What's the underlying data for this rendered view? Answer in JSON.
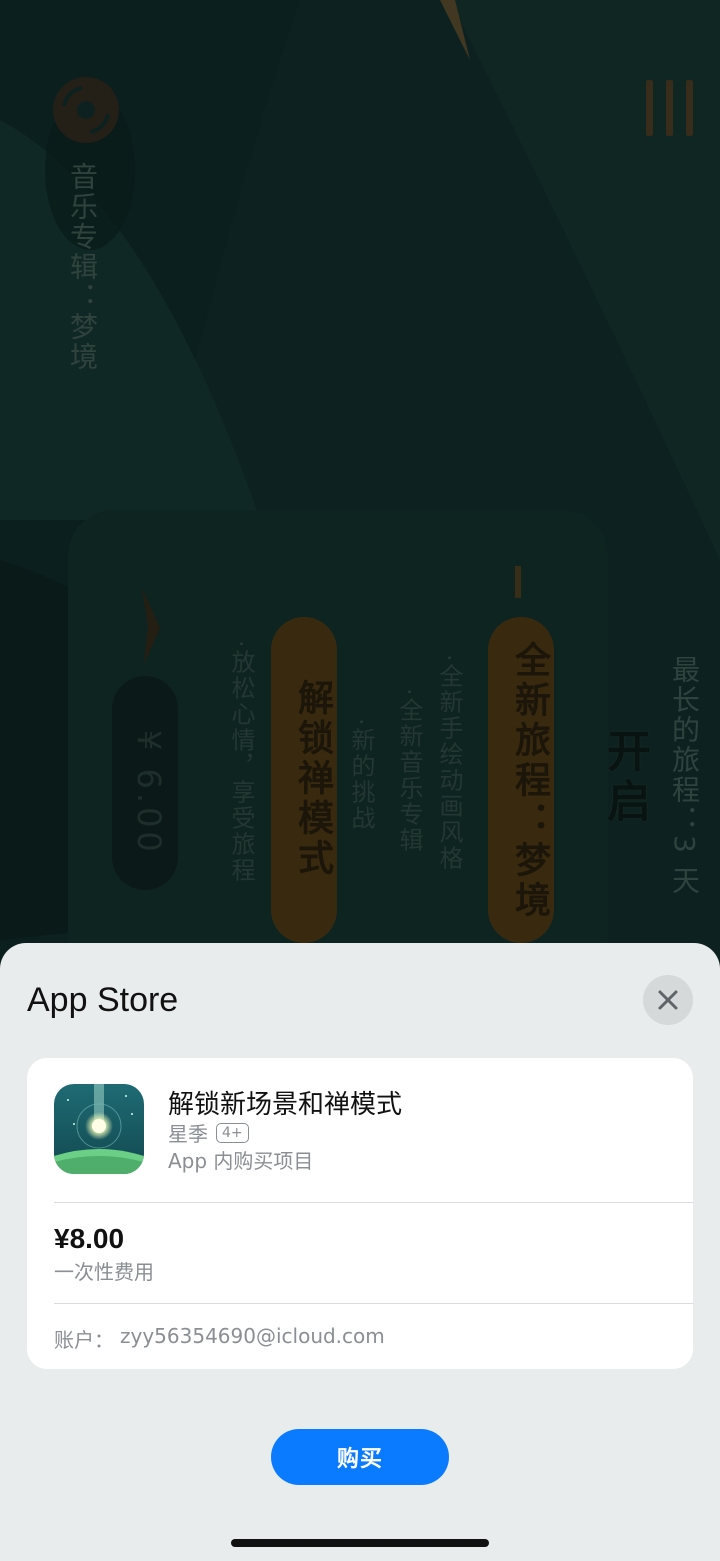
{
  "background": {
    "album_title": "音乐专辑：梦境",
    "longest_journey": "最长的旅程：3 天",
    "open_label": "开启",
    "journey_button": "全新旅程：梦境",
    "journey_features": [
      "·全新手绘动画风格",
      "·全新音乐专辑",
      "·新的挑战"
    ],
    "zen_button": "解锁禅模式",
    "zen_feature": "·放松心情，享受旅程",
    "price_tag": "¥ 6.00"
  },
  "sheet": {
    "title": "App Store",
    "close_icon": "close-icon",
    "item": {
      "title": "解锁新场景和禅模式",
      "developer": "星季",
      "age_rating": "4+",
      "type": "App 内购买项目"
    },
    "price": "¥8.00",
    "price_note": "一次性费用",
    "account_label": "账户：",
    "account_email": "zyy56354690@icloud.com",
    "buy_label": "购买"
  },
  "colors": {
    "accent": "#0a7bff",
    "sheet_bg": "#e9ecec",
    "background_teal": "#163834"
  }
}
